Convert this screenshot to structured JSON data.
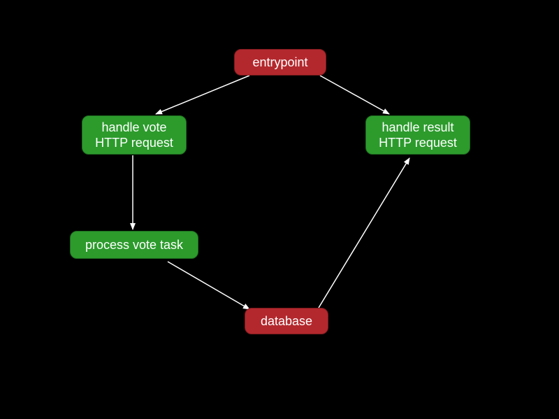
{
  "nodes": {
    "entrypoint": {
      "label": "entrypoint",
      "color": "red"
    },
    "handle_vote": {
      "label": "handle vote\nHTTP request",
      "color": "green"
    },
    "handle_result": {
      "label": "handle result\nHTTP request",
      "color": "green"
    },
    "process_vote": {
      "label": "process vote task",
      "color": "green"
    },
    "database": {
      "label": "database",
      "color": "red"
    }
  },
  "edges": [
    {
      "from": "entrypoint",
      "to": "handle_vote"
    },
    {
      "from": "entrypoint",
      "to": "handle_result"
    },
    {
      "from": "handle_vote",
      "to": "process_vote"
    },
    {
      "from": "process_vote",
      "to": "database"
    },
    {
      "from": "database",
      "to": "handle_result"
    }
  ],
  "colors": {
    "red": "#b3282d",
    "green": "#2c9b2c",
    "arrow": "#ffffff",
    "background": "#000000"
  }
}
